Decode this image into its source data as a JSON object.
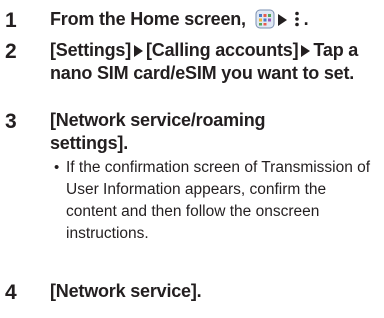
{
  "steps": [
    {
      "number": "1",
      "text_prefix": "From the Home screen,",
      "text_suffix": "."
    },
    {
      "number": "2",
      "seg1": "[Settings]",
      "seg2": "[Calling accounts]",
      "seg3": "Tap a nano SIM card/eSIM you want to set."
    },
    {
      "number": "3",
      "text": "[Network service/roaming settings]."
    },
    {
      "number": "4",
      "text": "[Network service]."
    }
  ],
  "note": {
    "bullet": "•",
    "text": "If the confirmation screen of Transmission of User Information appears, confirm the content and then follow the onscreen instructions."
  },
  "icons": [
    "home-app-icon",
    "arrow-icon",
    "more-menu-icon"
  ]
}
